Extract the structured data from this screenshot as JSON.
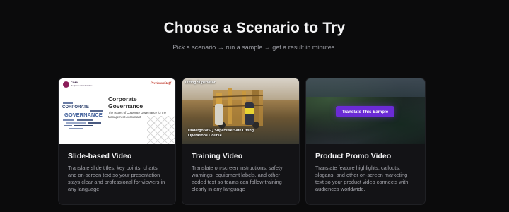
{
  "header": {
    "title": "Choose a Scenario to Try",
    "subtitle": "Pick a scenario → run a sample → get a result in minutes."
  },
  "colors": {
    "background": "#0b0b0c",
    "card": "#131316",
    "accent": "#6b2bd6"
  },
  "cards": [
    {
      "title": "Slide-based Video",
      "description": "Translate slide titles, key points, charts, and on-screen text so your presentation stays clear and professional for viewers in any language.",
      "thumbnail": {
        "logo_left_text": "CIMA",
        "logo_left_sub": "Registered for Practice",
        "logo_right": "PrecisionStaff",
        "slide_title": "Corporate Governance",
        "slide_body": "The Issues of Corporate Governance for the Management Accountant",
        "wordcloud_words": [
          "CORPORATE",
          "GOVERNANCE"
        ]
      }
    },
    {
      "title": "Training Video",
      "description": "Translate on-screen instructions, safety warnings, equipment labels, and other added text so teams can follow training clearly in any language",
      "thumbnail": {
        "overlay_top": "Lifting Supervisor",
        "overlay_bottom": "Undergo WSQ Supervise Safe Lifting Operations Course"
      }
    },
    {
      "title": "Product Promo Video",
      "description": "Translate feature highlights, callouts, slogans, and other on-screen marketing text so your product video connects with audiences worldwide.",
      "thumbnail": {
        "button_label": "Translate This Sample"
      }
    }
  ]
}
